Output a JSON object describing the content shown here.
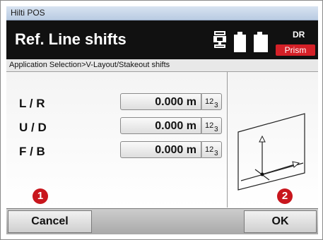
{
  "window": {
    "title": "Hilti POS"
  },
  "header": {
    "screen_title": "Ref. Line shifts",
    "instrument_icon": "total-station-icon",
    "battery_icons": [
      "battery-icon",
      "battery-icon"
    ],
    "face_label": "DR",
    "target_label": "Prism",
    "target_color": "#d42027"
  },
  "breadcrumb": "Application Selection>V-Layout/Stakeout shifts",
  "fields": [
    {
      "label": "L / R",
      "value": "0.000 m",
      "keyboard_icon": "numeric-keyboard-icon"
    },
    {
      "label": "U / D",
      "value": "0.000 m",
      "keyboard_icon": "numeric-keyboard-icon"
    },
    {
      "label": "F / B",
      "value": "0.000 m",
      "keyboard_icon": "numeric-keyboard-icon"
    }
  ],
  "keyboard_label": {
    "base": "12",
    "sub": "3"
  },
  "diagram": {
    "icon": "reference-line-axes-icon"
  },
  "softkeys": {
    "cancel": "Cancel",
    "ok": "OK"
  },
  "markers": {
    "cancel_marker": "1",
    "ok_marker": "2",
    "color": "#c8161d"
  }
}
